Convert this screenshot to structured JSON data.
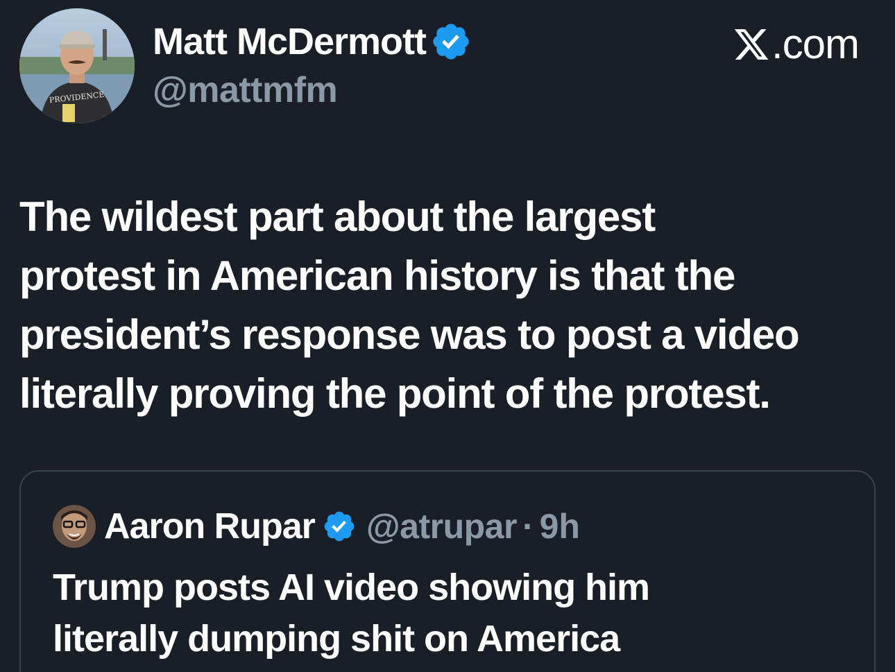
{
  "author": {
    "name": "Matt McDermott",
    "handle": "@mattmfm",
    "verified": true,
    "shirt_text": "PROVIDENCE"
  },
  "brand": {
    "label": ".com",
    "logo": "x-logo"
  },
  "tweet": {
    "lines": [
      "The wildest part about the largest",
      "protest in American history is that the",
      "president’s response was to post a video",
      "literally proving the point of the protest."
    ]
  },
  "quoted_tweet": {
    "name": "Aaron Rupar",
    "handle": "@atrupar",
    "separator": "·",
    "time": "9h",
    "verified": true,
    "lines": [
      "Trump posts AI video showing him",
      "literally dumping shit on America"
    ]
  },
  "colors": {
    "background": "#1a1f27",
    "text_primary": "#ffffff",
    "text_secondary": "#8b98a5",
    "verified_blue": "#1d9bf0",
    "card_border": "#38444d"
  },
  "icons": [
    "verified-badge-icon",
    "x-logo-icon"
  ]
}
